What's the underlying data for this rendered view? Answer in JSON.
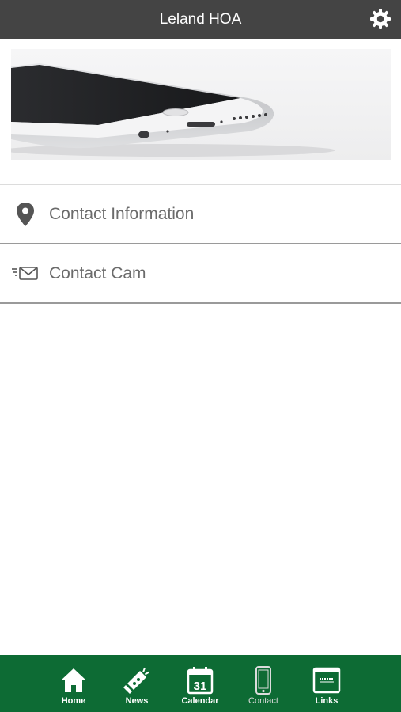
{
  "header": {
    "title": "Leland HOA",
    "settings_icon": "gear-icon"
  },
  "hero": {
    "image": "smartphone-photo"
  },
  "list": {
    "items": [
      {
        "label": "Contact Information",
        "icon": "map-pin-icon"
      },
      {
        "label": "Contact Cam",
        "icon": "envelope-icon"
      }
    ]
  },
  "tabbar": {
    "background": "#0d6b34",
    "active": "Contact",
    "tabs": [
      {
        "label": "Home",
        "icon": "home-icon"
      },
      {
        "label": "News",
        "icon": "megaphone-icon"
      },
      {
        "label": "Calendar",
        "icon": "calendar-icon",
        "icon_text": "31"
      },
      {
        "label": "Contact",
        "icon": "phone-icon"
      },
      {
        "label": "Links",
        "icon": "browser-icon"
      }
    ]
  },
  "colors": {
    "header_bg": "#444444",
    "list_text": "#6b6b6b",
    "divider": "#9a9a9a"
  }
}
